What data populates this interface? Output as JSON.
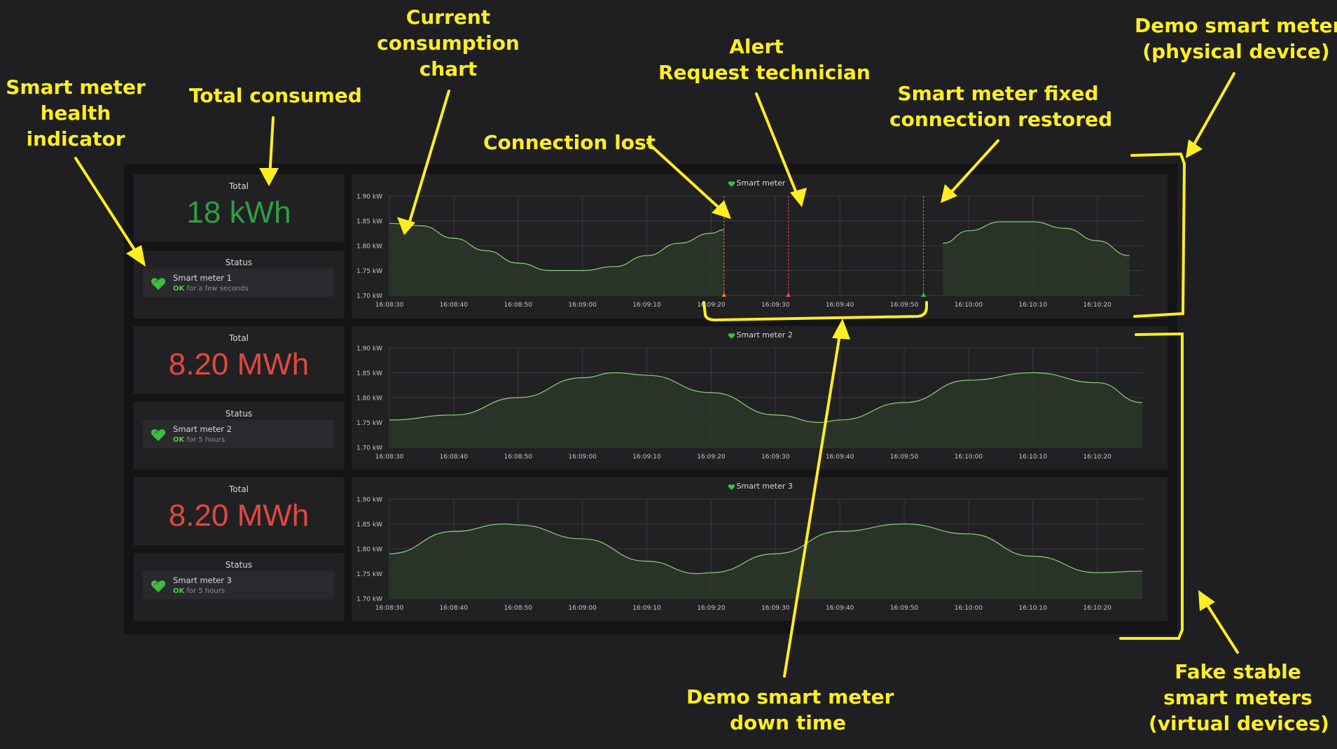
{
  "panels": [
    {
      "total_label": "Total",
      "total_value": "18 kWh",
      "total_color": "#2f9e44",
      "status_label": "Status",
      "meter_name": "Smart meter 1",
      "ok": "OK",
      "status_text": "for a few seconds",
      "chart_title": "Smart meter"
    },
    {
      "total_label": "Total",
      "total_value": "8.20 MWh",
      "total_color": "#e0483e",
      "status_label": "Status",
      "meter_name": "Smart meter 2",
      "ok": "OK",
      "status_text": "for 5 hours",
      "chart_title": "Smart meter 2"
    },
    {
      "total_label": "Total",
      "total_value": "8.20 MWh",
      "total_color": "#e0483e",
      "status_label": "Status",
      "meter_name": "Smart meter 3",
      "ok": "OK",
      "status_text": "for 5 hours",
      "chart_title": "Smart meter 3"
    }
  ],
  "colors": {
    "series_line": "#8fd17a",
    "series_fill": "#2c3a2a",
    "grid": "#3a3a3e",
    "axis_text": "#c7c7c7",
    "health_ok": "#3fbf3f",
    "annotation": "#ffee22",
    "alert_lost": "#e07a2c",
    "alert_tech": "#d94f3d",
    "alert_fixed": "#3fbf3f"
  },
  "annotations": {
    "health": "Smart meter\nhealth\nindicator",
    "total": "Total consumed",
    "chart": "Current\nconsumption\nchart",
    "lost": "Connection lost",
    "alert": "Alert\nRequest technician",
    "fixed": "Smart meter fixed\nconnection restored",
    "demo": "Demo smart meter\n(physical device)",
    "downtime": "Demo smart meter\ndown time",
    "fake": "Fake stable\nsmart meters\n(virtual devices)"
  },
  "chart_data": [
    {
      "type": "area",
      "title": "Smart meter",
      "x": [
        "16:08:30",
        "16:08:35",
        "16:08:40",
        "16:08:45",
        "16:08:50",
        "16:08:55",
        "16:09:00",
        "16:09:05",
        "16:09:10",
        "16:09:15",
        "16:09:20",
        "16:09:22",
        "16:09:56",
        "16:10:00",
        "16:10:05",
        "16:10:10",
        "16:10:15",
        "16:10:20",
        "16:10:25"
      ],
      "y": [
        1.845,
        1.84,
        1.815,
        1.79,
        1.765,
        1.75,
        1.75,
        1.758,
        1.78,
        1.805,
        1.825,
        1.832,
        1.805,
        1.83,
        1.848,
        1.848,
        1.835,
        1.81,
        1.78
      ],
      "gap": [
        "16:09:22",
        "16:09:56"
      ],
      "events": [
        {
          "time": "16:09:22",
          "kind": "connection-lost"
        },
        {
          "time": "16:09:32",
          "kind": "alert"
        },
        {
          "time": "16:09:53",
          "kind": "fixed"
        }
      ],
      "y_ticks": [
        "1.70 kW",
        "1.75 kW",
        "1.80 kW",
        "1.85 kW",
        "1.90 kW"
      ],
      "x_ticks": [
        "16:08:30",
        "16:08:40",
        "16:08:50",
        "16:09:00",
        "16:09:10",
        "16:09:20",
        "16:09:30",
        "16:09:40",
        "16:09:50",
        "16:10:00",
        "16:10:10",
        "16:10:20"
      ],
      "ylim": [
        1.7,
        1.9
      ],
      "xlim": [
        "16:08:30",
        "16:10:27"
      ]
    },
    {
      "type": "area",
      "title": "Smart meter 2",
      "x": [
        "16:08:30",
        "16:08:40",
        "16:08:50",
        "16:09:00",
        "16:09:05",
        "16:09:10",
        "16:09:20",
        "16:09:30",
        "16:09:37",
        "16:09:40",
        "16:09:50",
        "16:10:00",
        "16:10:10",
        "16:10:20",
        "16:10:27"
      ],
      "y": [
        1.755,
        1.765,
        1.8,
        1.84,
        1.85,
        1.845,
        1.81,
        1.765,
        1.75,
        1.755,
        1.79,
        1.835,
        1.85,
        1.83,
        1.79
      ],
      "y_ticks": [
        "1.70 kW",
        "1.75 kW",
        "1.80 kW",
        "1.85 kW",
        "1.90 kW"
      ],
      "x_ticks": [
        "16:08:30",
        "16:08:40",
        "16:08:50",
        "16:09:00",
        "16:09:10",
        "16:09:20",
        "16:09:30",
        "16:09:40",
        "16:09:50",
        "16:10:00",
        "16:10:10",
        "16:10:20"
      ],
      "ylim": [
        1.7,
        1.9
      ],
      "xlim": [
        "16:08:30",
        "16:10:27"
      ]
    },
    {
      "type": "area",
      "title": "Smart meter 3",
      "x": [
        "16:08:30",
        "16:08:40",
        "16:08:48",
        "16:08:50",
        "16:09:00",
        "16:09:10",
        "16:09:18",
        "16:09:20",
        "16:09:30",
        "16:09:40",
        "16:09:50",
        "16:10:00",
        "16:10:10",
        "16:10:20",
        "16:10:27"
      ],
      "y": [
        1.79,
        1.835,
        1.85,
        1.848,
        1.82,
        1.775,
        1.75,
        1.752,
        1.79,
        1.835,
        1.85,
        1.83,
        1.785,
        1.752,
        1.755
      ],
      "y_ticks": [
        "1.70 kW",
        "1.75 kW",
        "1.80 kW",
        "1.85 kW",
        "1.90 kW"
      ],
      "x_ticks": [
        "16:08:30",
        "16:08:40",
        "16:08:50",
        "16:09:00",
        "16:09:10",
        "16:09:20",
        "16:09:30",
        "16:09:40",
        "16:09:50",
        "16:10:00",
        "16:10:10",
        "16:10:20"
      ],
      "ylim": [
        1.7,
        1.9
      ],
      "xlim": [
        "16:08:30",
        "16:10:27"
      ]
    }
  ]
}
